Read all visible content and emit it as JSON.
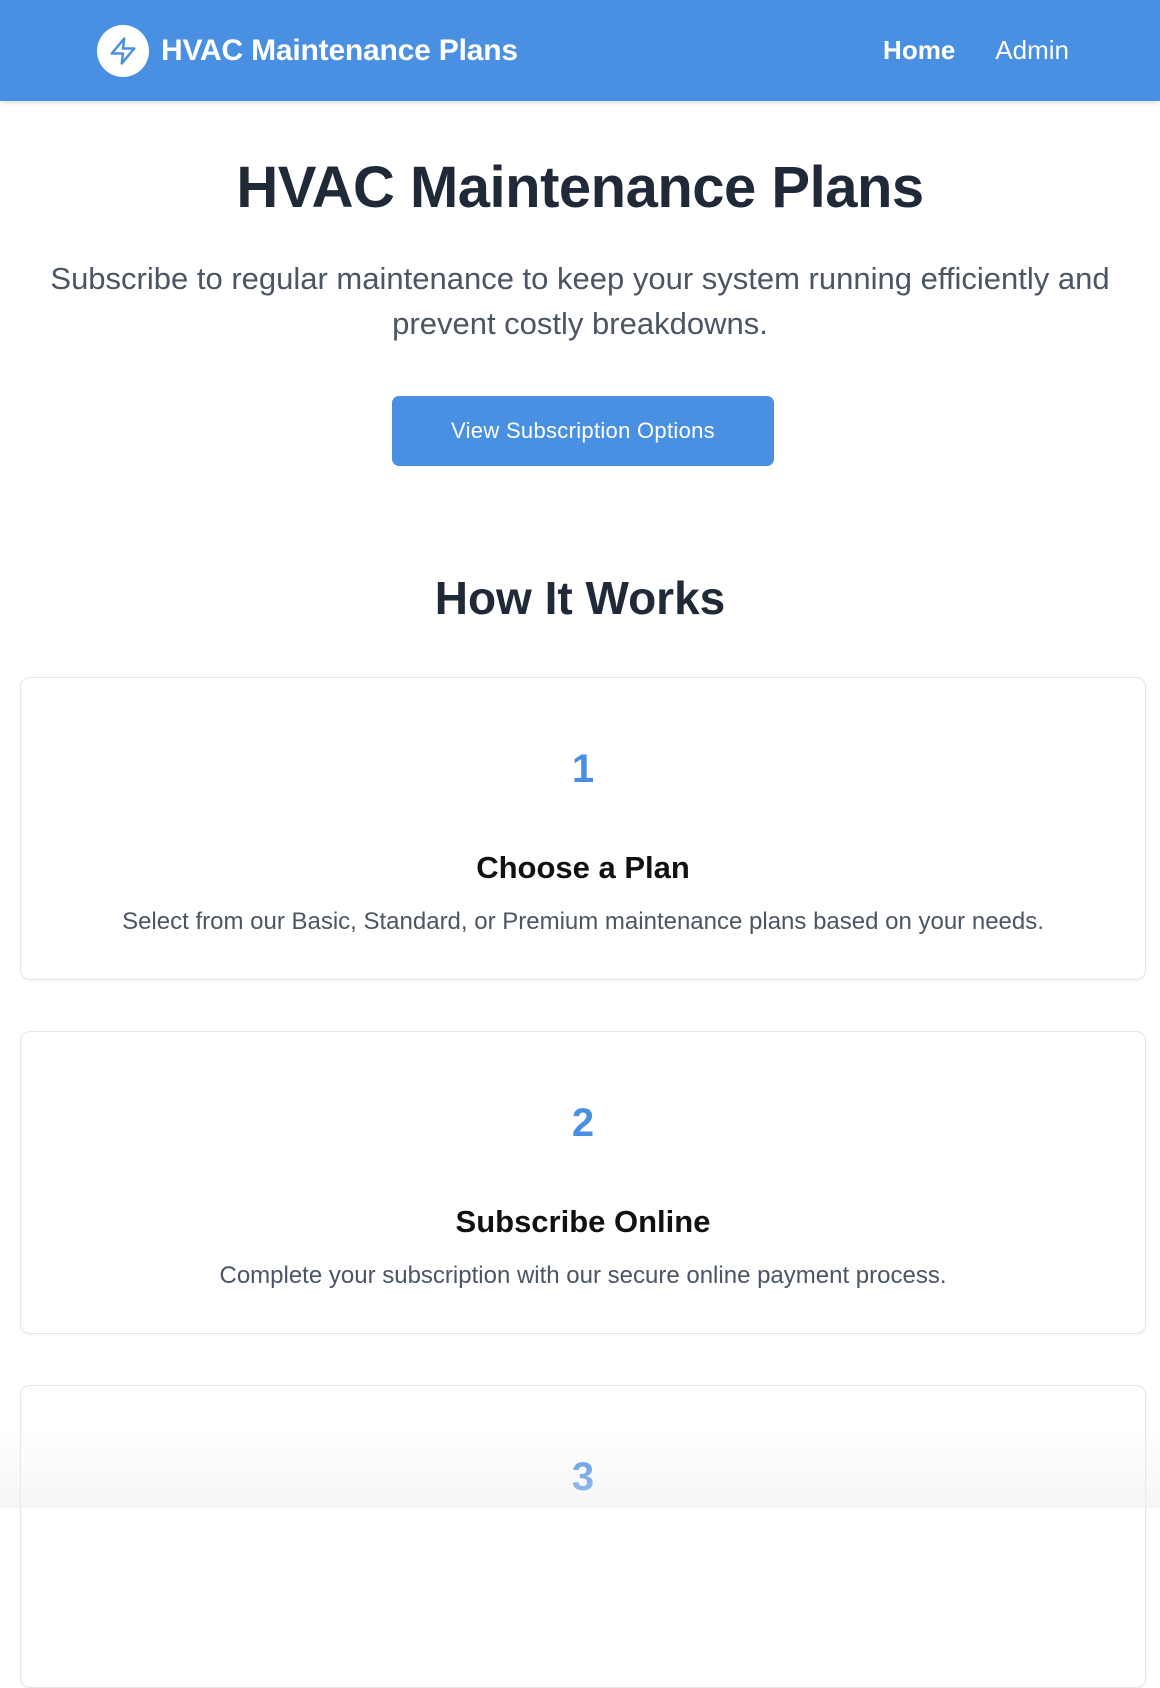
{
  "nav": {
    "brand_title": "HVAC Maintenance Plans",
    "brand_icon": "lightning-bolt-icon",
    "links": [
      {
        "label": "Home",
        "active": true
      },
      {
        "label": "Admin",
        "active": false
      }
    ]
  },
  "hero": {
    "title": "HVAC Maintenance Plans",
    "subtitle": "Subscribe to regular maintenance to keep your system running efficiently and prevent costly breakdowns.",
    "cta_label": "View Subscription Options"
  },
  "how_it_works": {
    "title": "How It Works",
    "steps": [
      {
        "number": "1",
        "title": "Choose a Plan",
        "description": "Select from our Basic, Standard, or Premium maintenance plans based on your needs."
      },
      {
        "number": "2",
        "title": "Subscribe Online",
        "description": "Complete your subscription with our secure online payment process."
      },
      {
        "number": "3",
        "title": "",
        "description": ""
      }
    ]
  },
  "colors": {
    "primary": "#4a90e2",
    "heading": "#1f2937",
    "body_text": "#4b5563",
    "card_border": "#e3e6ea"
  }
}
